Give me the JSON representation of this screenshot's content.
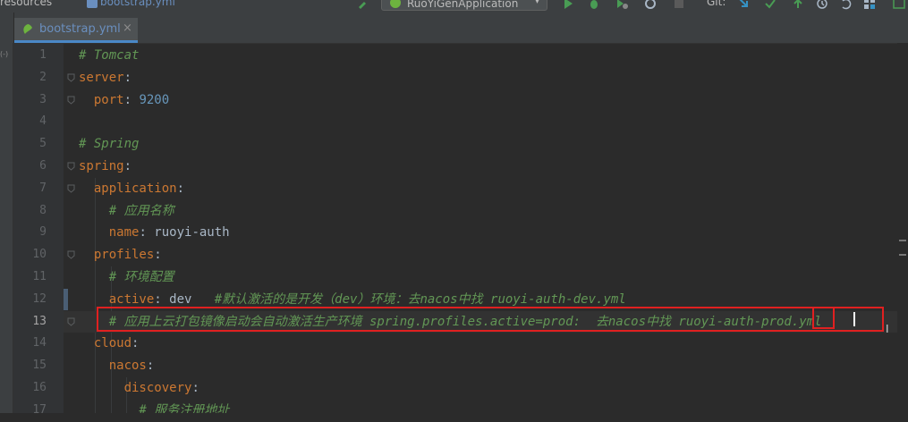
{
  "toolbar": {
    "breadcrumb_folder": "resources",
    "breadcrumb_file": "bootstrap.yml",
    "run_configuration": "RuoYiGenApplication",
    "git_label": "Git:",
    "colors": {
      "run": "#499c54",
      "git_update": "#3592c4",
      "git_commit": "#499c54"
    }
  },
  "tab": {
    "label": "bootstrap.yml",
    "close_glyph": "×",
    "icon": "yaml-file-icon"
  },
  "strip_label": "(-)",
  "editor": {
    "current_line": 13,
    "lines": [
      {
        "num": "1",
        "parts": [
          {
            "t": "# Tomcat",
            "c": "cmt"
          }
        ]
      },
      {
        "num": "2",
        "parts": [
          {
            "t": "server",
            "c": "key"
          },
          {
            "t": ":",
            "c": "val"
          }
        ]
      },
      {
        "num": "3",
        "parts": [
          {
            "t": "  port",
            "c": "key"
          },
          {
            "t": ": ",
            "c": "val"
          },
          {
            "t": "9200",
            "c": "num"
          }
        ]
      },
      {
        "num": "4",
        "parts": []
      },
      {
        "num": "5",
        "parts": [
          {
            "t": "# Spring",
            "c": "cmt"
          }
        ]
      },
      {
        "num": "6",
        "parts": [
          {
            "t": "spring",
            "c": "key"
          },
          {
            "t": ":",
            "c": "val"
          }
        ]
      },
      {
        "num": "7",
        "parts": [
          {
            "t": "  application",
            "c": "key"
          },
          {
            "t": ":",
            "c": "val"
          }
        ]
      },
      {
        "num": "8",
        "parts": [
          {
            "t": "    # 应用名称",
            "c": "cmt"
          }
        ]
      },
      {
        "num": "9",
        "parts": [
          {
            "t": "    name",
            "c": "key"
          },
          {
            "t": ": ruoyi-auth",
            "c": "val"
          }
        ]
      },
      {
        "num": "10",
        "parts": [
          {
            "t": "  profiles",
            "c": "key"
          },
          {
            "t": ":",
            "c": "val"
          }
        ]
      },
      {
        "num": "11",
        "parts": [
          {
            "t": "    # 环境配置",
            "c": "cmt"
          }
        ]
      },
      {
        "num": "12",
        "parts": [
          {
            "t": "    active",
            "c": "key"
          },
          {
            "t": ": dev   ",
            "c": "val"
          },
          {
            "t": "#默认激活的是开发（dev）环境：去nacos中找 ruoyi-auth-dev.yml",
            "c": "cmt"
          }
        ]
      },
      {
        "num": "13",
        "parts": [
          {
            "t": "    # 应用上云打包镜像启动会自动激活生产环境 spring.profiles.active=prod:  去nacos中找 ruoyi-auth-prod.yml",
            "c": "cmt"
          }
        ]
      },
      {
        "num": "14",
        "parts": [
          {
            "t": "  cloud",
            "c": "key"
          },
          {
            "t": ":",
            "c": "val"
          }
        ]
      },
      {
        "num": "15",
        "parts": [
          {
            "t": "    nacos",
            "c": "key"
          },
          {
            "t": ":",
            "c": "val"
          }
        ]
      },
      {
        "num": "16",
        "parts": [
          {
            "t": "      discovery",
            "c": "key"
          },
          {
            "t": ":",
            "c": "val"
          }
        ]
      },
      {
        "num": "17",
        "parts": [
          {
            "t": "        # 服务注册地址",
            "c": "cmt"
          }
        ]
      }
    ]
  },
  "colors": {
    "annotation_red": "#e02020",
    "key_orange": "#cc7832",
    "comment_green": "#629755",
    "number_blue": "#6897bb",
    "text": "#a9b7c6",
    "background": "#2b2b2b"
  }
}
